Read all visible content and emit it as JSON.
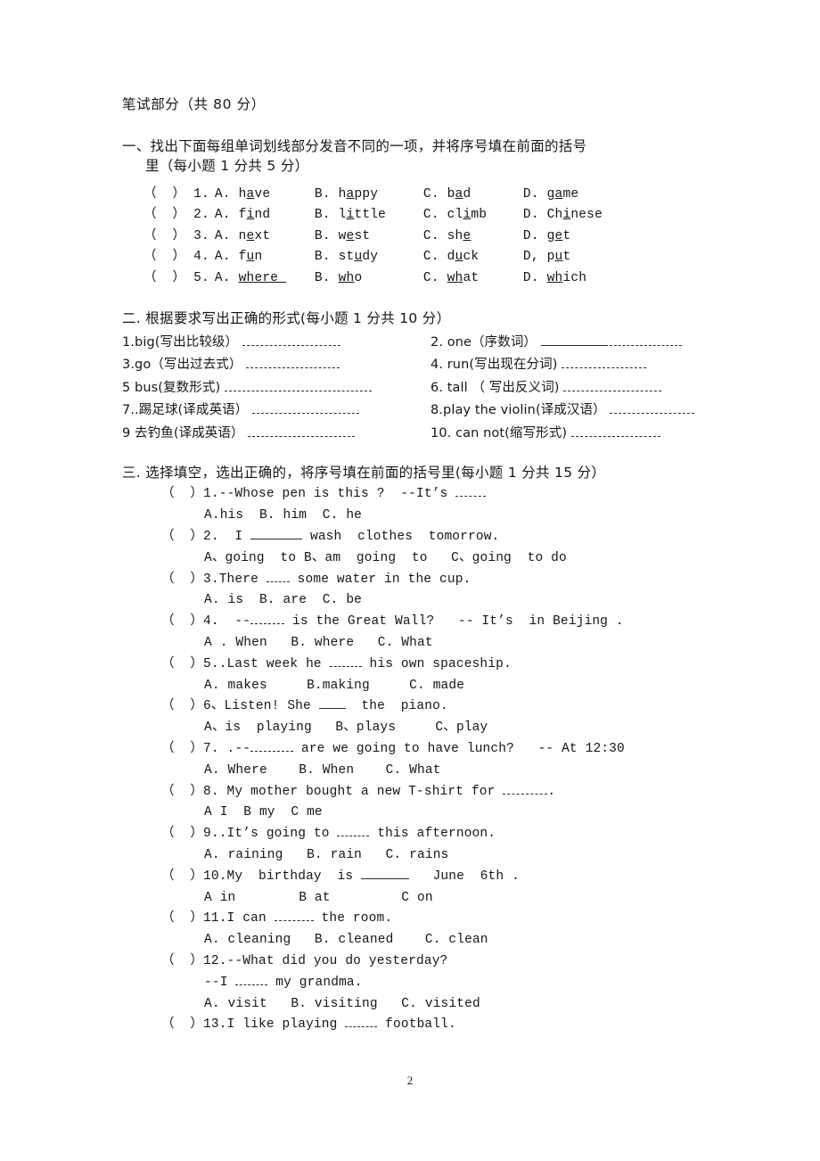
{
  "document": {
    "title": "笔试部分（共 80 分）",
    "page_number": "2"
  },
  "section1": {
    "heading_line1": "一、找出下面每组单词划线部分发音不同的一项，并将序号填在前面的括号",
    "heading_line2": "里（每小题 1 分共 5 分）",
    "rows": [
      {
        "bracket": "（  ）",
        "number": "1.",
        "options": [
          {
            "label": "A.",
            "pre": "h",
            "mark": "a",
            "post": "ve"
          },
          {
            "label": "B.",
            "pre": "h",
            "mark": "a",
            "post": "ppy"
          },
          {
            "label": "C.",
            "pre": "b",
            "mark": "a",
            "post": "d"
          },
          {
            "label": "D.",
            "pre": "g",
            "mark": "a",
            "post": "me"
          }
        ]
      },
      {
        "bracket": "（  ）",
        "number": "2.",
        "options": [
          {
            "label": "A.",
            "pre": "f",
            "mark": "i",
            "post": "nd"
          },
          {
            "label": "B.",
            "pre": "l",
            "mark": "i",
            "post": "ttle"
          },
          {
            "label": "C.",
            "pre": "cl",
            "mark": "i",
            "post": "mb"
          },
          {
            "label": "D.",
            "pre": "Ch",
            "mark": "i",
            "post": "nese"
          }
        ]
      },
      {
        "bracket": "（  ）",
        "number": "3.",
        "options": [
          {
            "label": "A.",
            "pre": "n",
            "mark": "e",
            "post": "xt"
          },
          {
            "label": "B.",
            "pre": "w",
            "mark": "e",
            "post": "st"
          },
          {
            "label": "C.",
            "pre": "sh",
            "mark": "e",
            "post": ""
          },
          {
            "label": "D.",
            "pre": "g",
            "mark": "e",
            "post": "t"
          }
        ]
      },
      {
        "bracket": "（  ）",
        "number": "4.",
        "options": [
          {
            "label": "A.",
            "pre": "f",
            "mark": "u",
            "post": "n"
          },
          {
            "label": "B.",
            "pre": "st",
            "mark": "u",
            "post": "dy"
          },
          {
            "label": "C.",
            "pre": "d",
            "mark": "u",
            "post": "ck"
          },
          {
            "label": "D,",
            "pre": "p",
            "mark": "u",
            "post": "t"
          }
        ]
      },
      {
        "bracket": "（  ）",
        "number": "5.",
        "options": [
          {
            "label": "A.",
            "pre": "",
            "mark": "where ",
            "post": ""
          },
          {
            "label": "B.",
            "pre": "",
            "mark": "wh",
            "post": "o"
          },
          {
            "label": "C.",
            "pre": "",
            "mark": "wh",
            "post": "at"
          },
          {
            "label": "D.",
            "pre": "",
            "mark": "wh",
            "post": "ich"
          }
        ]
      }
    ]
  },
  "section2": {
    "heading": "二.   根据要求写出正确的形式(每小题 1 分共 10 分）",
    "items": [
      {
        "left": "1.big(写出比较级）",
        "left_blank": "dash-110",
        "right": "2. one（序数词）",
        "right_blank": "solid-then-dash"
      },
      {
        "left": "3.go（写出过去式）",
        "left_blank": "dash-105",
        "right": "4. run(写出现在分词)",
        "right_blank": "dash-95"
      },
      {
        "left": "5 bus(复数形式)",
        "left_blank": "dash-165",
        "right": "6. tall （ 写出反义词)",
        "right_blank": "dash-110"
      },
      {
        "left": "7..踢足球(译成英语）",
        "left_blank": "dash-120",
        "right": "8.play the violin(译成汉语）",
        "right_blank": "dash-95"
      },
      {
        "left": "9 去钓鱼(译成英语）",
        "left_blank": "dash-120",
        "right": "10. can not(缩写形式)",
        "right_blank": "dash-100"
      }
    ]
  },
  "section3": {
    "heading": "三. 选择填空，选出正确的，将序号填在前面的括号里(每小题 1 分共 15 分）",
    "questions": [
      {
        "stem": "（  ）1.--Whose pen is this ?  --It’s ",
        "blank": "dash-34",
        "stem_tail": "",
        "options": "A.his  B. him  C. he"
      },
      {
        "stem": "（  ）2.  I ",
        "blank": "solid-58",
        "stem_tail": " wash  clothes  tomorrow.",
        "options": "A、going  to B、am  going  to   C、going  to do"
      },
      {
        "stem": "（  ）3.There ",
        "blank": "dash-26",
        "stem_tail": " some water in the cup.",
        "options": "A. is  B. are  C. be"
      },
      {
        "stem": "（  ）4.  --",
        "blank": "dash-38",
        "stem_tail": " is the Great Wall?   -- It’s  in Beijing .",
        "options": "A . When   B. where   C. What"
      },
      {
        "stem": "（  ）5..Last week he ",
        "blank": "dash-36",
        "stem_tail": " his own spaceship.",
        "options": "A. makes     B.making     C. made"
      },
      {
        "stem": "（  ）6、Listen! She ",
        "blank": "solid-30",
        "stem_tail": "  the  piano.",
        "options": "A、is  playing   B、plays     C、play"
      },
      {
        "stem": "（  ）7. .--",
        "blank": "dash-48",
        "stem_tail": " are we going to have lunch?   -- At 12:30",
        "options": "A. Where    B. When    C. What"
      },
      {
        "stem": "（  ）8. My mother bought a new T-shirt for ",
        "blank": "dash-50",
        "stem_tail": ".",
        "options": "A I  B my  C me"
      },
      {
        "stem": "（  ）9..It’s going to ",
        "blank": "dash-36",
        "stem_tail": " this afternoon.",
        "options": "A. raining   B. rain   C. rains"
      },
      {
        "stem": "（  ）10.My  birthday  is ",
        "blank": "solid-54",
        "stem_tail": "   June  6th .",
        "options": "A in        B at         C on"
      },
      {
        "stem": "（  ）11.I can ",
        "blank": "dash-44",
        "stem_tail": " the room.",
        "options": "A. cleaning   B. cleaned    C. clean"
      },
      {
        "stem": "（  ）12.--What did you do yesterday?",
        "blank": "",
        "stem_tail": "",
        "sub": "--I ",
        "sub_blank": "dash-36",
        "sub_tail": " my grandma.",
        "options": "A. visit   B. visiting   C. visited"
      },
      {
        "stem": "（  ）13.I like playing ",
        "blank": "dash-36",
        "stem_tail": " football.",
        "options": ""
      }
    ]
  }
}
